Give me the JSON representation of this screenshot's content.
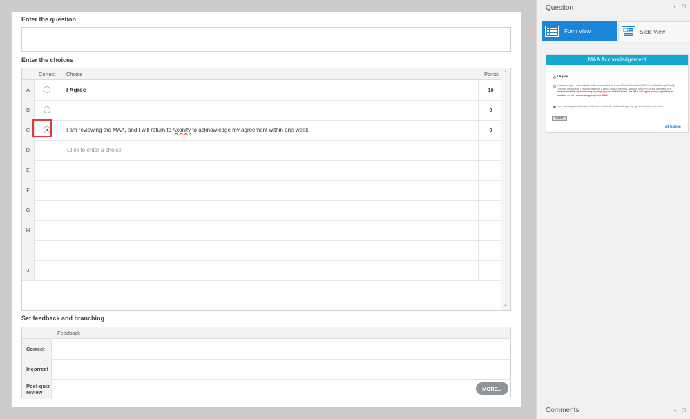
{
  "editor": {
    "question_label": "Enter the question",
    "question_value": "",
    "choices_label": "Enter the choices",
    "columns": {
      "correct": "Correct",
      "choice": "Choice",
      "points": "Points"
    },
    "choices": [
      {
        "letter": "A",
        "text": "I Agree",
        "points": "10",
        "selected": false,
        "bold": true
      },
      {
        "letter": "B",
        "text": "",
        "points": "0",
        "selected": false
      },
      {
        "letter": "C",
        "text_before": "I am reviewing the MAA, and I will return to ",
        "text_misspelled": "Axonify",
        "text_after": " to acknowledge my agreement within one week",
        "points": "0",
        "selected": true
      },
      {
        "letter": "D",
        "placeholder": "Click to enter a choice"
      },
      {
        "letter": "E"
      },
      {
        "letter": "F"
      },
      {
        "letter": "G"
      },
      {
        "letter": "H"
      },
      {
        "letter": "I"
      },
      {
        "letter": "J"
      }
    ],
    "feedback_label": "Set feedback and branching",
    "feedback_column": "Feedback",
    "feedback_rows": [
      {
        "label": "Correct",
        "value": "-"
      },
      {
        "label": "Incorrect",
        "value": "-"
      },
      {
        "label": "Post-quiz review",
        "value": ""
      }
    ],
    "more_button": "MORE..."
  },
  "right_panel": {
    "title": "Question",
    "form_view": "Form View",
    "slide_view": "Slide View",
    "comments": "Comments",
    "preview": {
      "title": "MAA Acknowledgement",
      "option1": "I Agree",
      "option2_text": "I refuse to sign. I acknowledge that I received this At Home Mutual Arbitration (\"MAA\") module through Axonify. Through the module, I received training, a digital copy of the MAA, and the option to request a printed copy.",
      "option2_bold": "I understand that by continuing my employment with At Home, the MAA will apply to me, regardless of whether or not I acknowledge/sign the MAA.",
      "option3": "I am reviewing the MAA, and I will return to Axonify to acknowledge my agreement within one week",
      "submit": "SUBMIT",
      "logo": "at home"
    }
  }
}
